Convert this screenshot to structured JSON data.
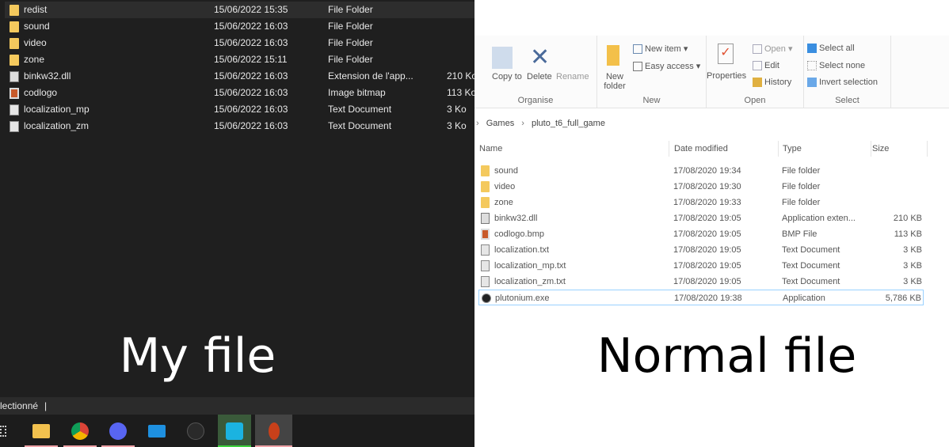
{
  "left": {
    "caption": "My file",
    "files": [
      {
        "name": "redist",
        "date": "15/06/2022 15:35",
        "type": "File Folder",
        "size": "",
        "icon": "folder-icon"
      },
      {
        "name": "sound",
        "date": "15/06/2022 16:03",
        "type": "File Folder",
        "size": "",
        "icon": "folder-icon"
      },
      {
        "name": "video",
        "date": "15/06/2022 16:03",
        "type": "File Folder",
        "size": "",
        "icon": "folder-icon"
      },
      {
        "name": "zone",
        "date": "15/06/2022 15:11",
        "type": "File Folder",
        "size": "",
        "icon": "folder-icon"
      },
      {
        "name": "binkw32.dll",
        "date": "15/06/2022 16:03",
        "type": "Extension de l'app...",
        "size": "210 Ko",
        "icon": "dll-icon"
      },
      {
        "name": "codlogo",
        "date": "15/06/2022 16:03",
        "type": "Image bitmap",
        "size": "113 Ko",
        "icon": "bitmap-icon"
      },
      {
        "name": "localization_mp",
        "date": "15/06/2022 16:03",
        "type": "Text Document",
        "size": "3 Ko",
        "icon": "text-document-icon"
      },
      {
        "name": "localization_zm",
        "date": "15/06/2022 16:03",
        "type": "Text Document",
        "size": "3 Ko",
        "icon": "text-document-icon"
      }
    ],
    "status": "lectionné",
    "taskbar": [
      "file-explorer-icon",
      "chrome-icon",
      "discord-icon",
      "mail-icon",
      "atom-icon",
      "remote-app-icon",
      "snipping-tool-icon"
    ]
  },
  "right": {
    "caption": "Normal file",
    "ribbon": {
      "organise": {
        "label": "Organise",
        "copy_to": "Copy to",
        "delete": "Delete",
        "rename": "Rename"
      },
      "new": {
        "label": "New",
        "new_folder": "New folder",
        "new_item": "New item",
        "easy_access": "Easy access"
      },
      "open": {
        "label": "Open",
        "properties": "Properties",
        "open": "Open",
        "edit": "Edit",
        "history": "History"
      },
      "select": {
        "label": "Select",
        "select_all": "Select all",
        "select_none": "Select none",
        "invert": "Invert selection"
      }
    },
    "breadcrumb": [
      "Games",
      "pluto_t6_full_game"
    ],
    "columns": [
      "Name",
      "Date modified",
      "Type",
      "Size"
    ],
    "files": [
      {
        "name": "sound",
        "date": "17/08/2020 19:34",
        "type": "File folder",
        "size": "",
        "icon": "folder-icon"
      },
      {
        "name": "video",
        "date": "17/08/2020 19:30",
        "type": "File folder",
        "size": "",
        "icon": "folder-icon"
      },
      {
        "name": "zone",
        "date": "17/08/2020 19:33",
        "type": "File folder",
        "size": "",
        "icon": "folder-icon"
      },
      {
        "name": "binkw32.dll",
        "date": "17/08/2020 19:05",
        "type": "Application exten...",
        "size": "210 KB",
        "icon": "dll-icon"
      },
      {
        "name": "codlogo.bmp",
        "date": "17/08/2020 19:05",
        "type": "BMP File",
        "size": "113 KB",
        "icon": "bitmap-icon"
      },
      {
        "name": "localization.txt",
        "date": "17/08/2020 19:05",
        "type": "Text Document",
        "size": "3 KB",
        "icon": "text-document-icon"
      },
      {
        "name": "localization_mp.txt",
        "date": "17/08/2020 19:05",
        "type": "Text Document",
        "size": "3 KB",
        "icon": "text-document-icon"
      },
      {
        "name": "localization_zm.txt",
        "date": "17/08/2020 19:05",
        "type": "Text Document",
        "size": "3 KB",
        "icon": "text-document-icon"
      },
      {
        "name": "plutonium.exe",
        "date": "17/08/2020 19:38",
        "type": "Application",
        "size": "5,786 KB",
        "icon": "plutonium-icon"
      }
    ]
  }
}
